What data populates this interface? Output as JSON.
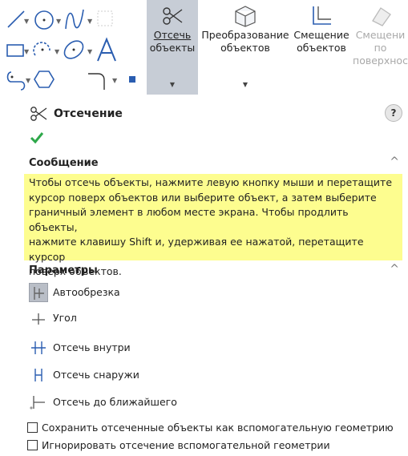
{
  "ribbon": {
    "tools": [
      {
        "name": "line-icon"
      },
      {
        "name": "circle-icon"
      },
      {
        "name": "spline-icon"
      },
      {
        "name": "rectangle-icon"
      },
      {
        "name": "polygon-arc-icon"
      },
      {
        "name": "ellipse-icon"
      },
      {
        "name": "text-icon"
      },
      {
        "name": "slot-icon"
      },
      {
        "name": "hexagon-icon"
      },
      {
        "name": "fillet-icon"
      },
      {
        "name": "point-icon"
      }
    ],
    "commands": [
      {
        "label1": "Отсечь",
        "label2": "объекты",
        "icon": "trim-icon",
        "active": true
      },
      {
        "label1": "Преобразование",
        "label2": "объектов",
        "icon": "convert-entities-icon"
      },
      {
        "label1": "Смещение",
        "label2": "объектов",
        "icon": "offset-entities-icon"
      },
      {
        "label1": "Смещени",
        "label2": "по",
        "label3": "поверхнос",
        "icon": "offset-surface-icon",
        "disabled": true
      }
    ]
  },
  "panel": {
    "title": "Отсечение",
    "help": "?",
    "message": {
      "heading": "Сообщение",
      "lines": [
        "Чтобы отсечь объекты, нажмите левую кнопку мыши и перетащите",
        "курсор поверх объектов или выберите объект, а затем выберите",
        "граничный элемент в любом месте экрана. Чтобы продлить объекты,",
        "нажмите клавишу Shift и, удерживая ее нажатой, перетащите курсор",
        "поверх объектов."
      ]
    },
    "params": {
      "heading": "Параметры",
      "options": [
        {
          "label": "Автообрезка",
          "selected": true
        },
        {
          "label": "Угол"
        },
        {
          "label": "Отсечь внутри"
        },
        {
          "label": "Отсечь снаружи"
        },
        {
          "label": "Отсечь до ближайшего"
        }
      ],
      "checkboxes": [
        {
          "label": "Сохранить отсеченные объекты как вспомогательную геометрию",
          "checked": false
        },
        {
          "label": "Игнорировать отсечение вспомогательной геометрии",
          "checked": false
        }
      ]
    }
  },
  "colors": {
    "accent": "#2f6fc2",
    "highlight": "#fdfd8f",
    "check": "#2ea84a",
    "active_bg": "#c7cdd6"
  }
}
